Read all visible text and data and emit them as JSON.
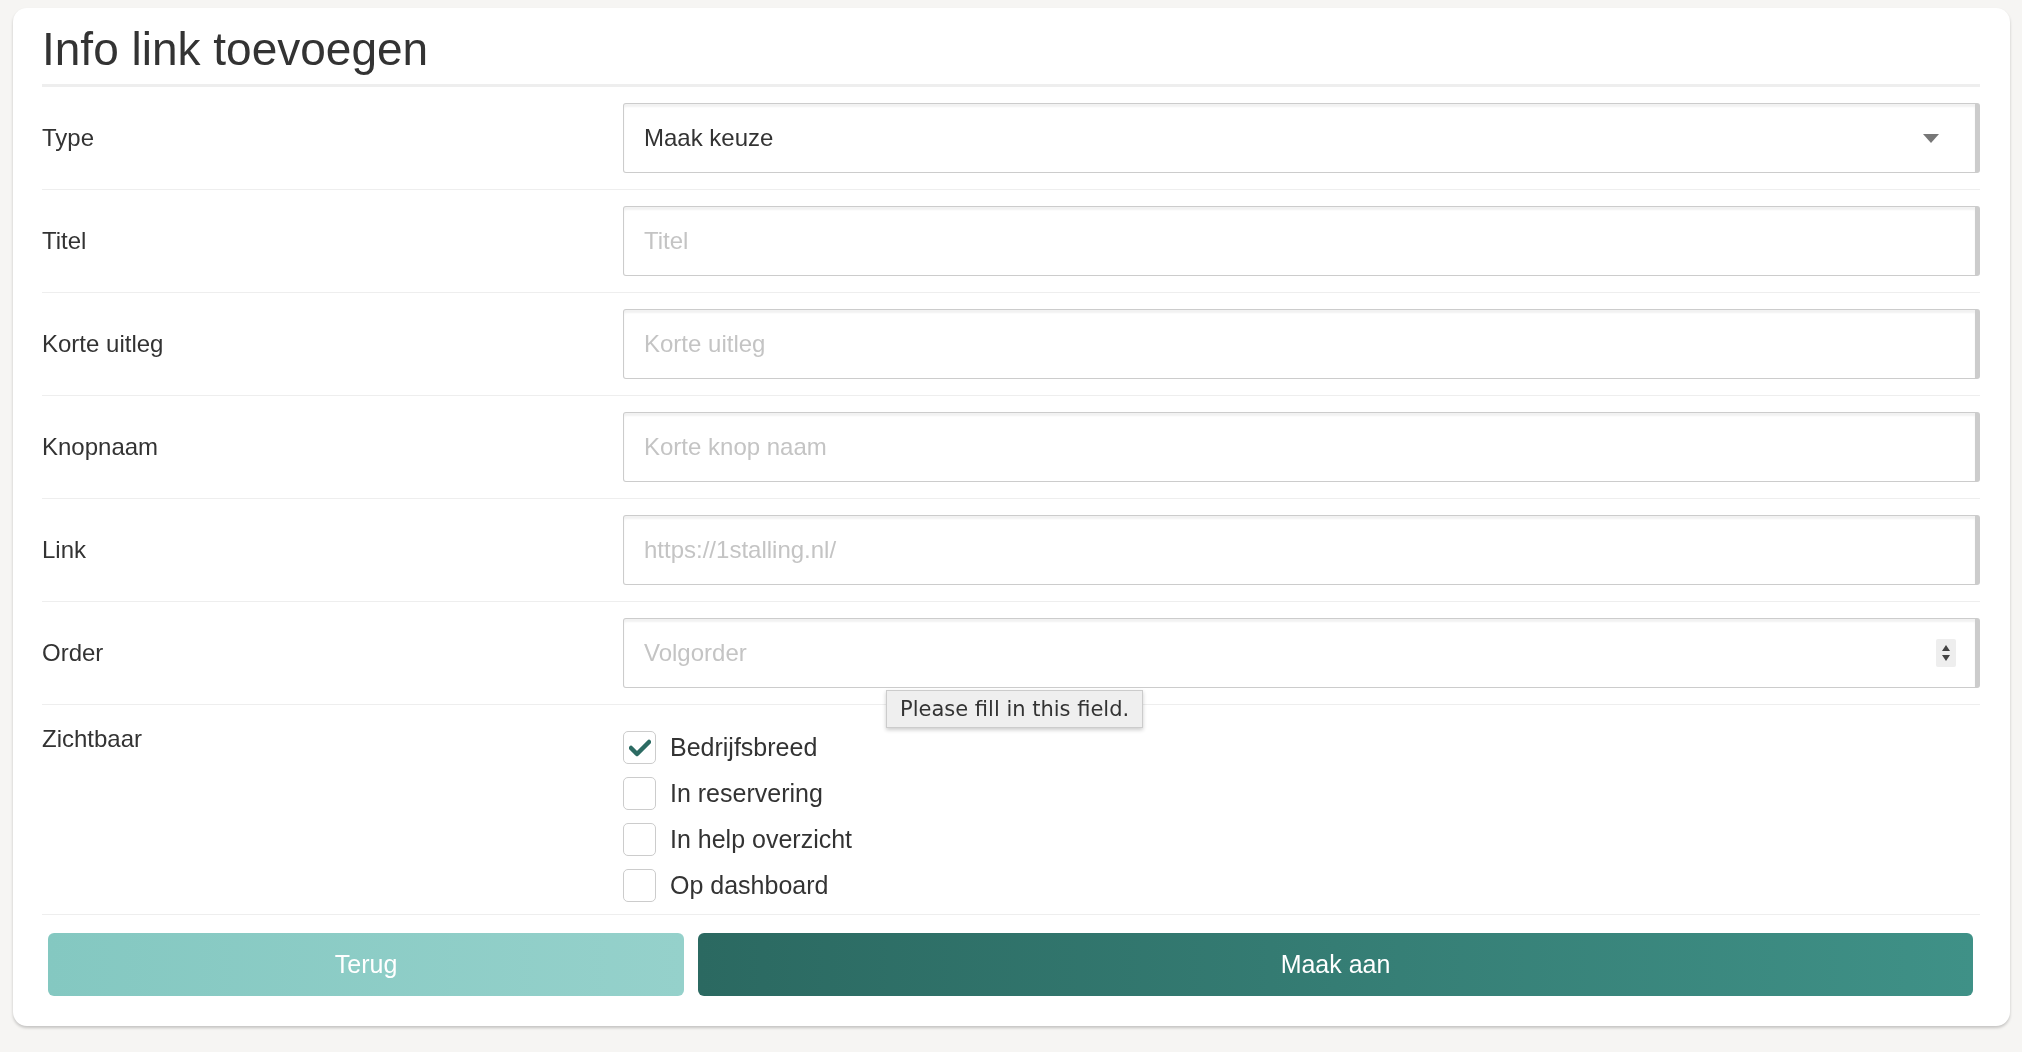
{
  "title": "Info link toevoegen",
  "fields": [
    {
      "kind": "select",
      "label": "Type",
      "value": "Maak keuze"
    },
    {
      "kind": "text",
      "label": "Titel",
      "placeholder": "Titel"
    },
    {
      "kind": "text",
      "label": "Korte uitleg",
      "placeholder": "Korte uitleg"
    },
    {
      "kind": "text",
      "label": "Knopnaam",
      "placeholder": "Korte knop naam"
    },
    {
      "kind": "text",
      "label": "Link",
      "placeholder": "https://1stalling.nl/"
    },
    {
      "kind": "number",
      "label": "Order",
      "placeholder": "Volgorder",
      "tooltip": "Please fill in this field."
    },
    {
      "kind": "checkboxes",
      "label": "Zichtbaar",
      "options": [
        {
          "label": "Bedrijfsbreed",
          "checked": true
        },
        {
          "label": "In reservering",
          "checked": false
        },
        {
          "label": "In help overzicht",
          "checked": false
        },
        {
          "label": "Op dashboard",
          "checked": false
        }
      ]
    }
  ],
  "buttons": [
    {
      "label": "Terug",
      "kind": "secondary"
    },
    {
      "label": "Maak aan",
      "kind": "primary"
    }
  ]
}
